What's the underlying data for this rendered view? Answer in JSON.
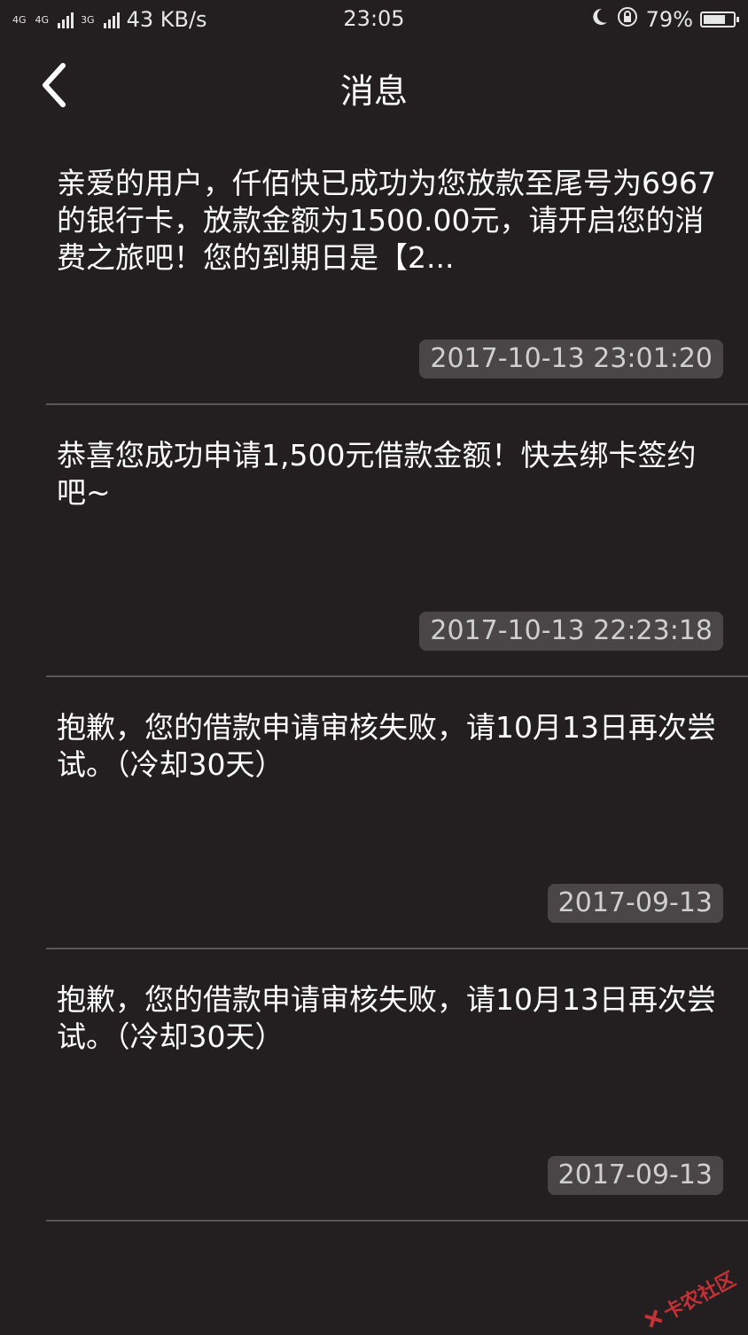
{
  "status_bar": {
    "net_a": "4G",
    "net_b": "4G",
    "net_c": "3G",
    "speed": "43 KB/s",
    "time": "23:05",
    "battery_percent": "79%",
    "battery_level": 0.79
  },
  "header": {
    "title": "消息"
  },
  "messages": [
    {
      "text": "亲爱的用户，仟佰快已成功为您放款至尾号为6967的银行卡，放款金额为1500.00元，请开启您的消费之旅吧！您的到期日是【2...",
      "time": "2017-10-13 23:01:20"
    },
    {
      "text": "恭喜您成功申请1,500元借款金额！快去绑卡签约吧~",
      "time": "2017-10-13 22:23:18"
    },
    {
      "text": "抱歉，您的借款申请审核失败，请10月13日再次尝试。（冷却30天）",
      "time": "2017-09-13"
    },
    {
      "text": "抱歉，您的借款申请审核失败，请10月13日再次尝试。（冷却30天）",
      "time": "2017-09-13"
    }
  ],
  "watermark": "卡农社区"
}
